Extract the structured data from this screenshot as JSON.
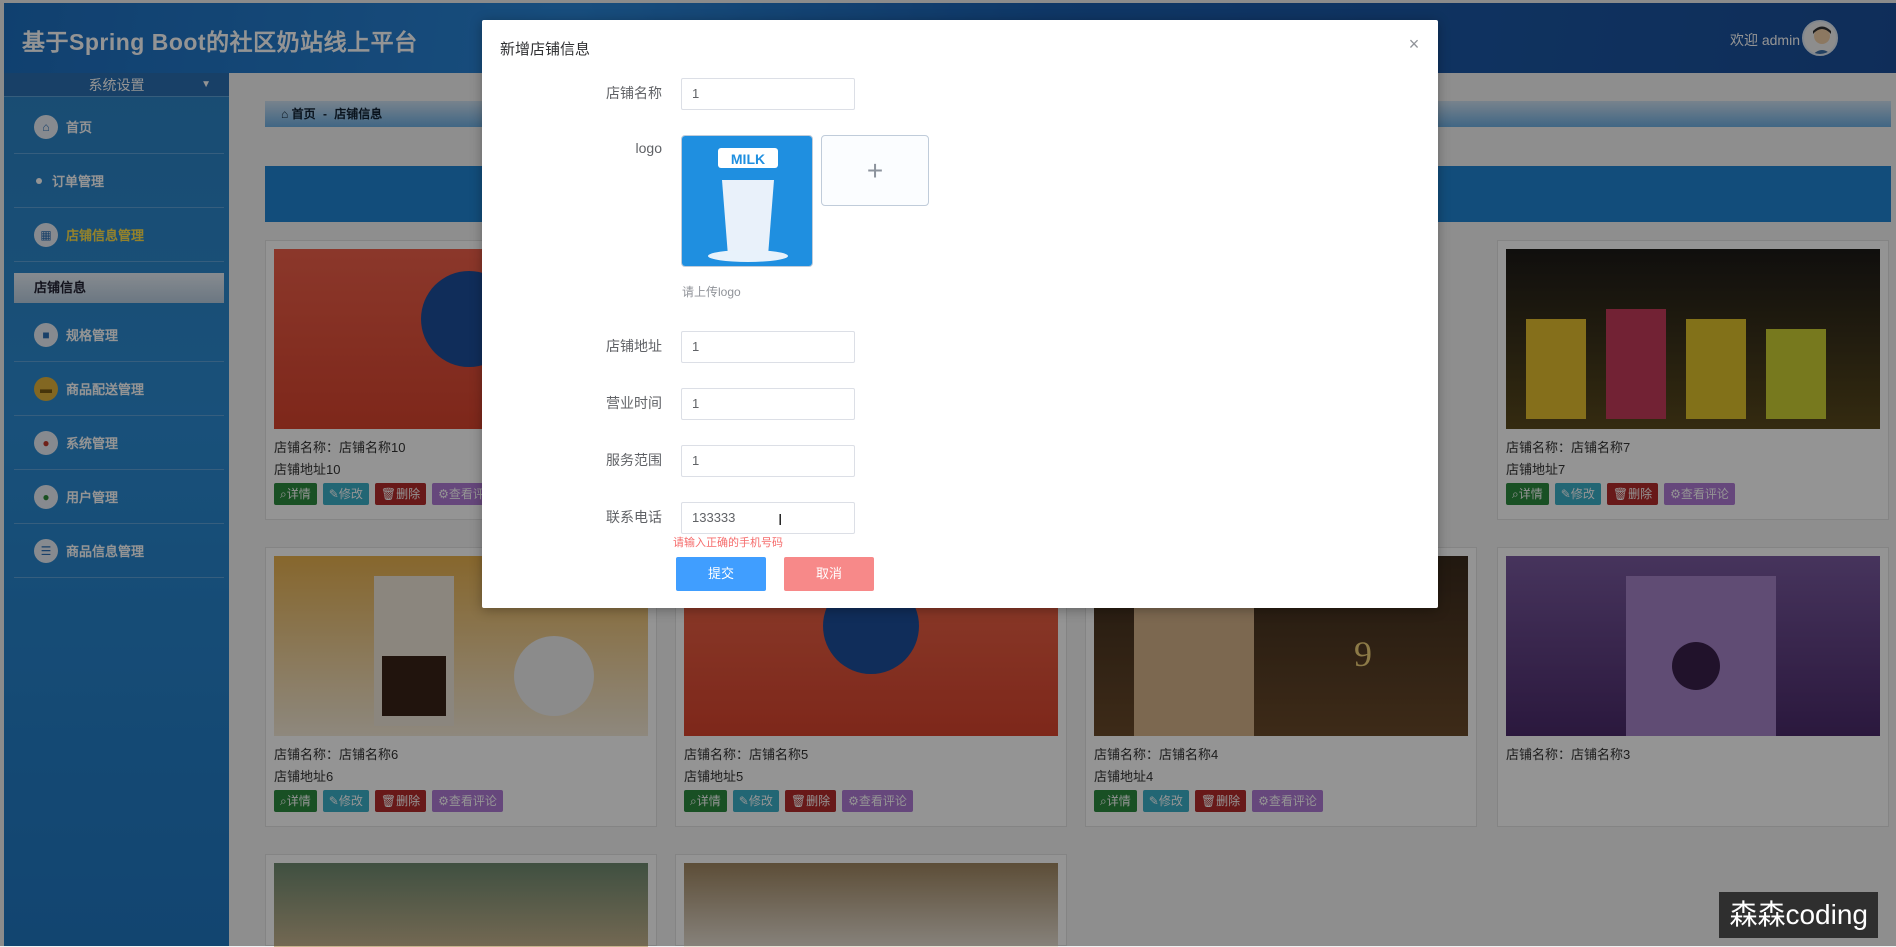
{
  "header": {
    "title": "基于Spring Boot的社区奶站线上平台",
    "welcome": "欢迎 admin"
  },
  "sidebar": {
    "section_title": "系统设置",
    "items": [
      {
        "label": "首页",
        "icon": "home-icon"
      },
      {
        "label": "订单管理",
        "icon": "dot-icon"
      },
      {
        "label": "店铺信息管理",
        "icon": "grid-icon",
        "active": true
      },
      {
        "label": "规格管理",
        "icon": "box-icon"
      },
      {
        "label": "商品配送管理",
        "icon": "folder-icon"
      },
      {
        "label": "系统管理",
        "icon": "gear-icon"
      },
      {
        "label": "用户管理",
        "icon": "user-icon"
      },
      {
        "label": "商品信息管理",
        "icon": "list-icon"
      }
    ],
    "active_submenu": "店铺信息"
  },
  "breadcrumb": {
    "home": "首页",
    "separator": "-",
    "current": "店铺信息"
  },
  "cards": [
    {
      "name": "店铺名称：店铺名称10",
      "address": "店铺地址10",
      "img_color": "#e85a3c"
    },
    {
      "name": "店铺名称：店铺名称7",
      "address": "店铺地址7",
      "img_color": "#c7a933"
    },
    {
      "name": "店铺名称：店铺名称6",
      "address": "店铺地址6",
      "img_color": "#d9b26b"
    },
    {
      "name": "店铺名称：店铺名称5",
      "address": "店铺地址5",
      "img_color": "#e2552f"
    },
    {
      "name": "店铺名称：店铺名称4",
      "address": "店铺地址4",
      "img_color": "#6a4a2a"
    },
    {
      "name": "店铺名称：店铺名称3",
      "address": "",
      "img_color": "#6d4b8a"
    }
  ],
  "card_buttons": {
    "detail": "详情",
    "edit": "修改",
    "delete": "删除",
    "review": "查看评论"
  },
  "dialog": {
    "title": "新增店铺信息",
    "fields": {
      "shop_name": {
        "label": "店铺名称",
        "value": "1"
      },
      "logo": {
        "label": "logo",
        "tip": "请上传logo"
      },
      "address": {
        "label": "店铺地址",
        "value": "1"
      },
      "hours": {
        "label": "营业时间",
        "value": "1"
      },
      "scope": {
        "label": "服务范围",
        "value": "1"
      },
      "phone": {
        "label": "联系电话",
        "value": "133333",
        "error": "请输入正确的手机号码"
      }
    },
    "submit": "提交",
    "cancel": "取消",
    "logo_text": "MILK"
  },
  "watermark": "森森coding"
}
